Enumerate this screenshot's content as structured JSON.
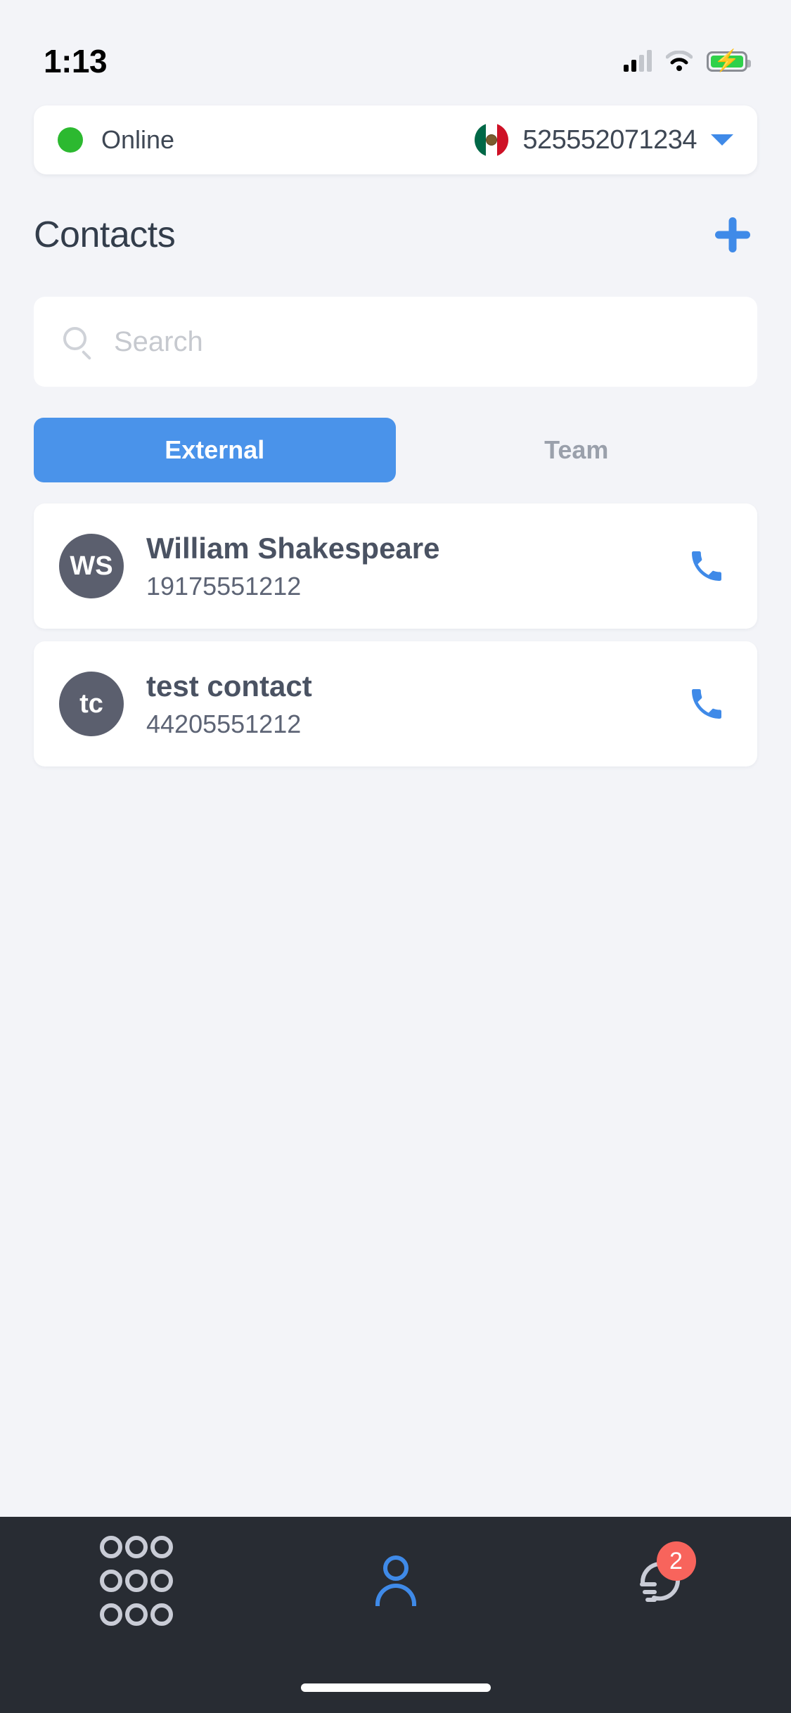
{
  "status_bar": {
    "time": "1:13",
    "signal_icon": "cellular-signal-icon",
    "signal_bars_filled": 2,
    "signal_bars_total": 4,
    "wifi_icon": "wifi-icon",
    "battery_icon": "battery-charging-icon",
    "battery_charging": true,
    "battery_color": "#2fd14a"
  },
  "account": {
    "presence_label": "Online",
    "presence_color": "#2cb930",
    "flag_icon": "mexico-flag-icon",
    "phone_number": "525552071234",
    "dropdown_icon": "chevron-down-icon",
    "dropdown_color": "#3f8ae8"
  },
  "header": {
    "title": "Contacts",
    "add_icon": "plus-icon",
    "add_color": "#3f8ae8"
  },
  "search": {
    "placeholder": "Search",
    "value": "",
    "icon": "search-icon"
  },
  "tabs": [
    {
      "label": "External",
      "active": true
    },
    {
      "label": "Team",
      "active": false
    }
  ],
  "tab_active_color": "#4a93ea",
  "contacts": [
    {
      "initials": "WS",
      "name": "William Shakespeare",
      "number": "19175551212",
      "call_icon": "phone-icon"
    },
    {
      "initials": "tc",
      "name": "test contact",
      "number": "44205551212",
      "call_icon": "phone-icon"
    }
  ],
  "bottom_nav": {
    "background": "#282c33",
    "items": [
      {
        "icon": "dialpad-icon",
        "active": false
      },
      {
        "icon": "contacts-person-icon",
        "active": true
      },
      {
        "icon": "call-history-headset-icon",
        "active": false,
        "badge": "2",
        "badge_color": "#f8645c"
      }
    ]
  }
}
